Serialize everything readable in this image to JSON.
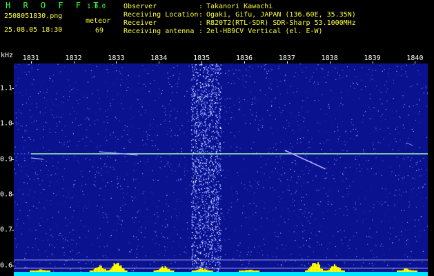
{
  "header": {
    "app_name": "H R O F F T",
    "app_version": "1.0.0",
    "file_name": "2508051830.png",
    "date_time": "25.08.05 18:30",
    "meteor_label": "meteor",
    "meteor_count": "69",
    "info": [
      {
        "key": "Observer",
        "value": "Takanori Kawachi"
      },
      {
        "key": "Receiving Location",
        "value": "Ogaki, Gifu, JAPAN (136.60E, 35.35N)"
      },
      {
        "key": "Receiver",
        "value": "R820T2(RTL-SDR) SDR-Sharp 53.1000MHz"
      },
      {
        "key": "Receiving antenna",
        "value": "2el-HB9CV Vertical (el. E-W)"
      }
    ],
    "separator": ":"
  },
  "chart_data": {
    "type": "heatmap",
    "ylabel": "kHz",
    "x_ticks": [
      "1831",
      "1832",
      "1833",
      "1834",
      "1835",
      "1836",
      "1837",
      "1838",
      "1839",
      "1840"
    ],
    "y_ticks": [
      "1.1",
      "1.0",
      "0.9",
      "0.8",
      "0.7",
      "0.6"
    ],
    "xlim": [
      1830.6,
      1840.3
    ],
    "ylim": [
      0.57,
      1.17
    ],
    "carrier_khz": 0.915,
    "colors": {
      "background": "#0a1290",
      "noise": "#3a52e0",
      "carrier": "#a8ffb0",
      "bottom": "#00e5ff",
      "peak": "#ffff00"
    }
  }
}
